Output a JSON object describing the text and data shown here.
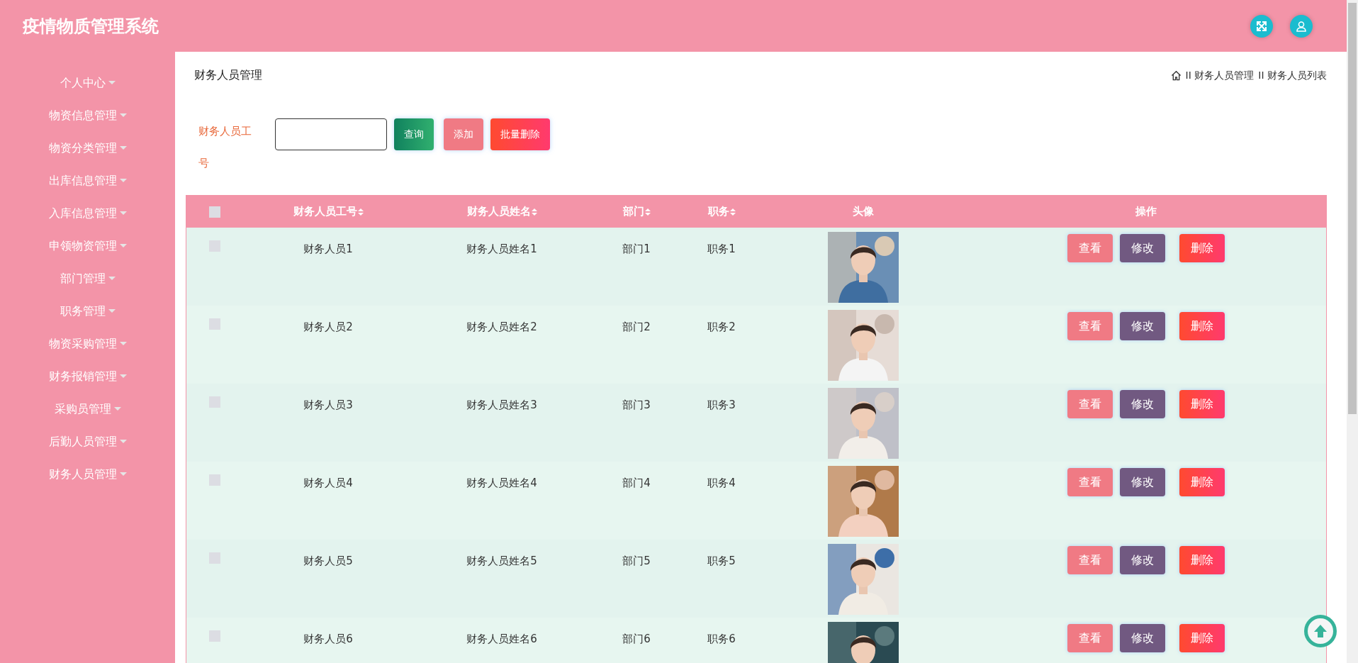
{
  "header": {
    "title": "疫情物质管理系统"
  },
  "sidebar": {
    "items": [
      {
        "label": "个人中心"
      },
      {
        "label": "物资信息管理"
      },
      {
        "label": "物资分类管理"
      },
      {
        "label": "出库信息管理"
      },
      {
        "label": "入库信息管理"
      },
      {
        "label": "申领物资管理"
      },
      {
        "label": "部门管理"
      },
      {
        "label": "职务管理"
      },
      {
        "label": "物资采购管理"
      },
      {
        "label": "财务报销管理"
      },
      {
        "label": "采购员管理"
      },
      {
        "label": "后勤人员管理"
      },
      {
        "label": "财务人员管理"
      }
    ]
  },
  "page_title": "财务人员管理",
  "breadcrumb": [
    "II 财务人员管理",
    "II 财务人员列表"
  ],
  "search": {
    "label": "财务人员工号",
    "buttons": [
      {
        "label": "查询",
        "kind": "search"
      },
      {
        "label": "添加",
        "kind": "add"
      },
      {
        "label": "批量删除",
        "kind": "delete"
      }
    ]
  },
  "table": {
    "select_all_checked": false,
    "columns": [
      {
        "label": "财务人员工号",
        "sortable": true
      },
      {
        "label": "财务人员姓名",
        "sortable": true
      },
      {
        "label": "部门",
        "sortable": true
      },
      {
        "label": "职务",
        "sortable": true
      },
      {
        "label": "头像",
        "sortable": false
      },
      {
        "label": "操作",
        "sortable": false
      }
    ],
    "rows": [
      {
        "checked": false,
        "cells": [
          "财务人员1",
          "财务人员姓名1",
          "部门1",
          "职务1"
        ],
        "avatar": {
          "kind": "picture"
        },
        "actions": [
          {
            "label": "查看",
            "kind": "view"
          },
          {
            "label": "修改",
            "kind": "edit"
          },
          {
            "label": "删除",
            "kind": "delete"
          }
        ]
      },
      {
        "checked": false,
        "cells": [
          "财务人员2",
          "财务人员姓名2",
          "部门2",
          "职务2"
        ],
        "avatar": {
          "kind": "picture"
        },
        "actions": [
          {
            "label": "查看",
            "kind": "view"
          },
          {
            "label": "修改",
            "kind": "edit"
          },
          {
            "label": "删除",
            "kind": "delete"
          }
        ]
      },
      {
        "checked": false,
        "cells": [
          "财务人员3",
          "财务人员姓名3",
          "部门3",
          "职务3"
        ],
        "avatar": {
          "kind": "picture"
        },
        "actions": [
          {
            "label": "查看",
            "kind": "view"
          },
          {
            "label": "修改",
            "kind": "edit"
          },
          {
            "label": "删除",
            "kind": "delete"
          }
        ]
      },
      {
        "checked": false,
        "cells": [
          "财务人员4",
          "财务人员姓名4",
          "部门4",
          "职务4"
        ],
        "avatar": {
          "kind": "picture"
        },
        "actions": [
          {
            "label": "查看",
            "kind": "view"
          },
          {
            "label": "修改",
            "kind": "edit"
          },
          {
            "label": "删除",
            "kind": "delete"
          }
        ]
      },
      {
        "checked": false,
        "cells": [
          "财务人员5",
          "财务人员姓名5",
          "部门5",
          "职务5"
        ],
        "avatar": {
          "kind": "picture"
        },
        "actions": [
          {
            "label": "查看",
            "kind": "view"
          },
          {
            "label": "修改",
            "kind": "edit"
          },
          {
            "label": "删除",
            "kind": "delete"
          }
        ]
      },
      {
        "checked": false,
        "cells": [
          "财务人员6",
          "财务人员姓名6",
          "部门6",
          "职务6"
        ],
        "avatar": {
          "kind": "picture"
        },
        "actions": [
          {
            "label": "查看",
            "kind": "view"
          },
          {
            "label": "修改",
            "kind": "edit"
          },
          {
            "label": "删除",
            "kind": "delete"
          }
        ]
      }
    ]
  }
}
